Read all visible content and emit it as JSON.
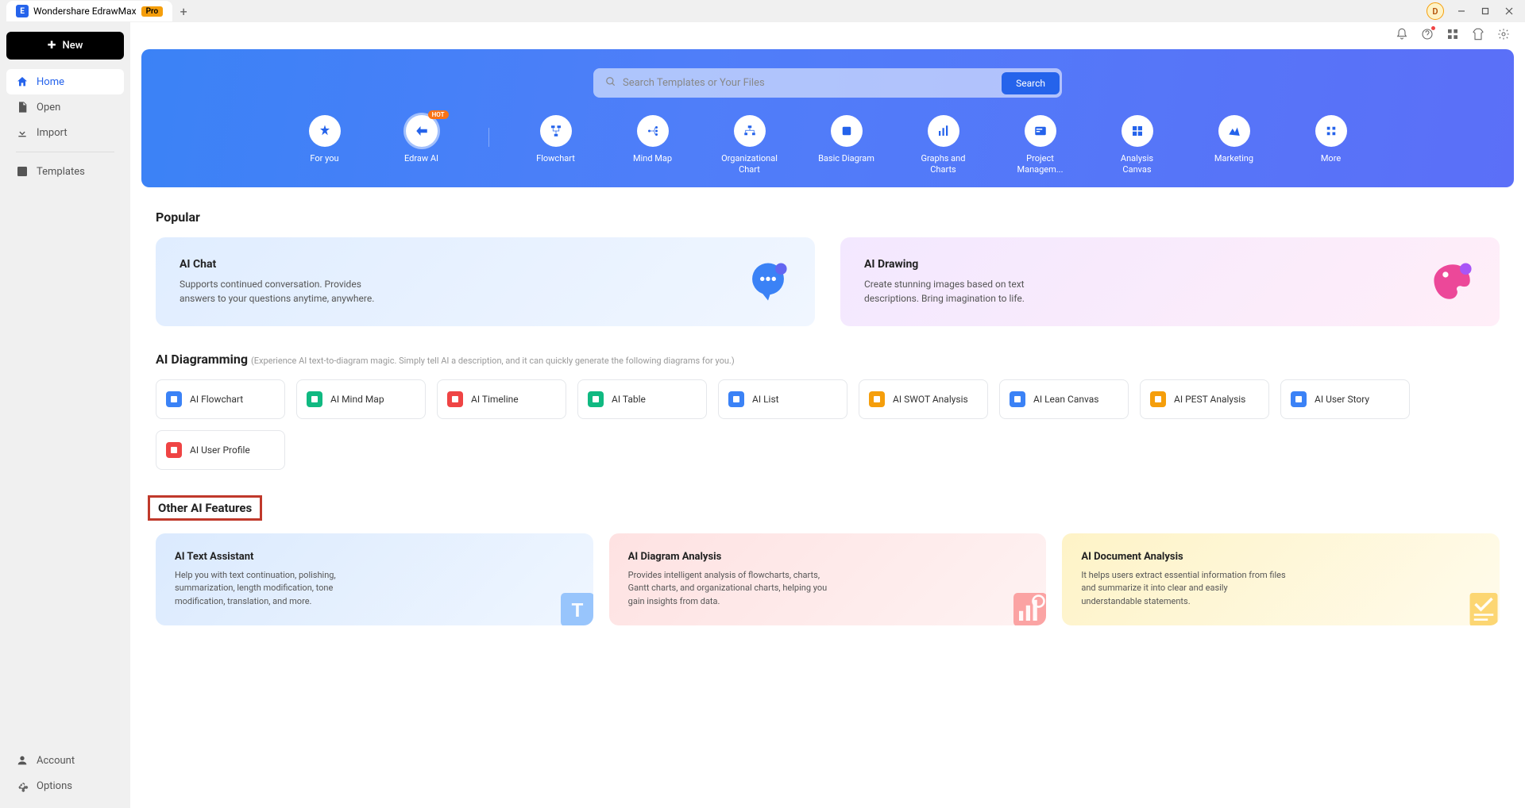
{
  "titlebar": {
    "app_name": "Wondershare EdrawMax",
    "pro": "Pro",
    "avatar_letter": "D"
  },
  "sidebar": {
    "new_label": "New",
    "items": [
      {
        "label": "Home"
      },
      {
        "label": "Open"
      },
      {
        "label": "Import"
      },
      {
        "label": "Templates"
      }
    ],
    "bottom": [
      {
        "label": "Account"
      },
      {
        "label": "Options"
      }
    ]
  },
  "search": {
    "placeholder": "Search Templates or Your Files",
    "button": "Search"
  },
  "categories": [
    {
      "label": "For you"
    },
    {
      "label": "Edraw AI",
      "hot": "HOT"
    },
    {
      "label": "Flowchart"
    },
    {
      "label": "Mind Map"
    },
    {
      "label": "Organizational Chart"
    },
    {
      "label": "Basic Diagram"
    },
    {
      "label": "Graphs and Charts"
    },
    {
      "label": "Project Managem..."
    },
    {
      "label": "Analysis Canvas"
    },
    {
      "label": "Marketing"
    },
    {
      "label": "More"
    }
  ],
  "popular": {
    "title": "Popular",
    "cards": [
      {
        "title": "AI Chat",
        "desc": "Supports continued conversation. Provides answers to your questions anytime, anywhere."
      },
      {
        "title": "AI Drawing",
        "desc": "Create stunning images based on text descriptions. Bring imagination to life."
      }
    ]
  },
  "ai_diagramming": {
    "title": "AI Diagramming",
    "subtitle": "(Experience AI text-to-diagram magic.  Simply tell AI a description, and it can quickly generate the following diagrams for you.)",
    "items": [
      {
        "label": "AI Flowchart",
        "color": "#3b82f6"
      },
      {
        "label": "AI Mind Map",
        "color": "#10b981"
      },
      {
        "label": "AI Timeline",
        "color": "#ef4444"
      },
      {
        "label": "AI Table",
        "color": "#10b981"
      },
      {
        "label": "AI List",
        "color": "#3b82f6"
      },
      {
        "label": "AI SWOT Analysis",
        "color": "#f59e0b"
      },
      {
        "label": "AI Lean Canvas",
        "color": "#3b82f6"
      },
      {
        "label": "AI PEST Analysis",
        "color": "#f59e0b"
      },
      {
        "label": "AI User Story",
        "color": "#3b82f6"
      },
      {
        "label": "AI User Profile",
        "color": "#ef4444"
      }
    ]
  },
  "other": {
    "title": "Other AI Features",
    "cards": [
      {
        "title": "AI Text Assistant",
        "desc": "Help you with text continuation, polishing, summarization, length modification, tone modification, translation, and more."
      },
      {
        "title": "AI Diagram Analysis",
        "desc": "Provides intelligent analysis of flowcharts, charts, Gantt charts, and organizational charts, helping you gain insights from data."
      },
      {
        "title": "AI Document Analysis",
        "desc": "It helps users extract essential information from files and summarize it into clear and easily understandable statements."
      }
    ]
  }
}
